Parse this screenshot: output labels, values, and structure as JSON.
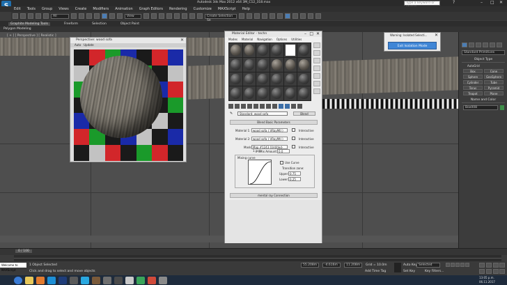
{
  "window": {
    "title": "Autodesk 3ds Max 2012 x64     3M_C12_318.max",
    "search_placeholder": "Type a keyword or phrase"
  },
  "menu": [
    "Edit",
    "Tools",
    "Group",
    "Views",
    "Create",
    "Modifiers",
    "Animation",
    "Graph Editors",
    "Rendering",
    "Customize",
    "MAXScript",
    "Help"
  ],
  "toolbar": {
    "selection_filter": "All",
    "ref_coord": "View",
    "named_selection": "Create Selection Se"
  },
  "ribbon": {
    "tabs": [
      "Graphite Modeling Tools",
      "Freeform",
      "Selection",
      "Object Paint"
    ],
    "active": "Graphite Modeling Tools",
    "sub": "Polygon Modeling"
  },
  "viewport": {
    "label": "[ + ] [ Perspective ] [ Realistic ]"
  },
  "persp_window": {
    "title": "Perspective: wood sofa",
    "tools": [
      "Auto",
      "Update"
    ]
  },
  "material_editor": {
    "title": "Material Editor - techn",
    "menu": [
      "Modes",
      "Material",
      "Navigation",
      "Options",
      "Utilities"
    ],
    "material_name": "Standard: wood sofa",
    "material_type": "Blend",
    "rollout_blend": "Blend Basic Parameters",
    "rows": [
      {
        "label": "Material 1:",
        "value": "wood sofa ( VRayMtl )",
        "check": "Interactive"
      },
      {
        "label": "Material 2:",
        "value": "wood sofa ( VRayMtl )",
        "check": "Interactive"
      },
      {
        "label": "Mask:",
        "value": "Map #1243 (Untitled-1.jpg)",
        "check": "Interactive"
      }
    ],
    "mix_amount_label": "Mix Amount:",
    "mix_amount": "0.0",
    "mixing_curve_label": "Mixing curve",
    "use_curve": "Use Curve",
    "transition_zone": "Transition zone:",
    "upper_label": "Upper:",
    "upper": "0.75",
    "lower_label": "Lower:",
    "lower": "0.25",
    "rollout_connection": "mental ray Connection"
  },
  "warning": {
    "title": "Warning: Isolated Selecti...",
    "button": "Exit Isolation Mode"
  },
  "command_panel": {
    "dropdown": "Standard Primitives",
    "section_object_type": "Object Type",
    "autogrid": "AutoGrid",
    "buttons": [
      "Box",
      "Cone",
      "Sphere",
      "GeoSphere",
      "Cylinder",
      "Tube",
      "Torus",
      "Pyramid",
      "Teapot",
      "Plane"
    ],
    "section_name_color": "Name and Color",
    "name_value": "Box008"
  },
  "timeline": {
    "frame": "0 / 100"
  },
  "status": {
    "selected": "1 Object Selected",
    "prompt": "Click and drag to select and move objects",
    "x": "55.208m",
    "y": "-4.616m",
    "z": "11.208m",
    "grid": "Grid = 10.0m",
    "autokey": "Auto Key",
    "set_key": "Set Key",
    "key_mode": "Selected",
    "key_filters": "Key Filters...",
    "add_time_tag": "Add Time Tag",
    "script_listener": "Welcome to MAXScript"
  },
  "clock": {
    "time": "13:05 p.m.",
    "date": "06.11.2017"
  }
}
